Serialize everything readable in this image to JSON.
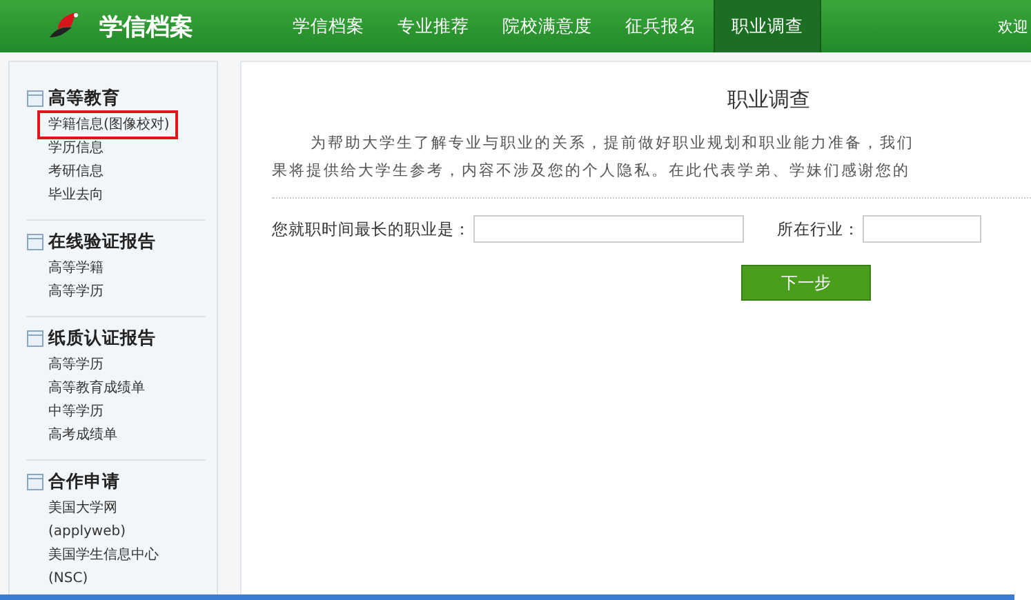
{
  "header": {
    "site_title": "学信档案",
    "nav": [
      {
        "label": "学信档案",
        "selected": false
      },
      {
        "label": "专业推荐",
        "selected": false
      },
      {
        "label": "院校满意度",
        "selected": false
      },
      {
        "label": "征兵报名",
        "selected": false
      },
      {
        "label": "职业调查",
        "selected": true
      }
    ],
    "welcome": "欢迎"
  },
  "sidebar": {
    "sections": [
      {
        "title": "高等教育",
        "items": [
          {
            "label": "学籍信息(图像校对)",
            "selected": true
          },
          {
            "label": "学历信息",
            "selected": false
          },
          {
            "label": "考研信息",
            "selected": false
          },
          {
            "label": "毕业去向",
            "selected": false
          }
        ]
      },
      {
        "title": "在线验证报告",
        "items": [
          {
            "label": "高等学籍",
            "selected": false
          },
          {
            "label": "高等学历",
            "selected": false
          }
        ]
      },
      {
        "title": "纸质认证报告",
        "items": [
          {
            "label": "高等学历",
            "selected": false
          },
          {
            "label": "高等教育成绩单",
            "selected": false
          },
          {
            "label": "中等学历",
            "selected": false
          },
          {
            "label": "高考成绩单",
            "selected": false
          }
        ]
      },
      {
        "title": "合作申请",
        "items": [
          {
            "label": "美国大学网",
            "selected": false
          },
          {
            "label": "(applyweb)",
            "selected": false
          },
          {
            "label": "美国学生信息中心",
            "selected": false
          },
          {
            "label": "(NSC)",
            "selected": false
          }
        ]
      }
    ]
  },
  "main": {
    "title": "职业调查",
    "intro": [
      "为帮助大学生了解专业与职业的关系，提前做好职业规划和职业能力准备，我们",
      "果将提供给大学生参考，内容不涉及您的个人隐私。在此代表学弟、学妹们感谢您的"
    ],
    "fields": [
      {
        "label": "您就职时间最长的职业是："
      },
      {
        "label": "所在行业："
      }
    ],
    "next_button": "下一步"
  }
}
